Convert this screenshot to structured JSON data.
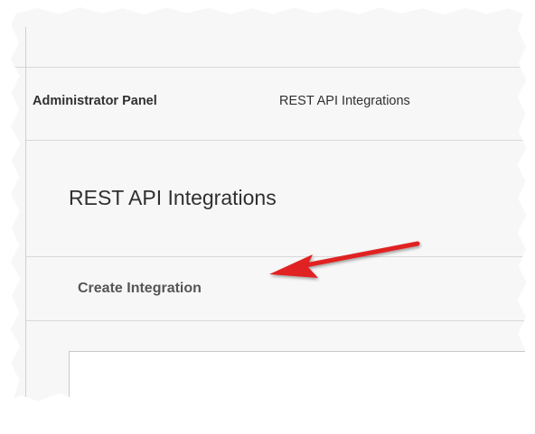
{
  "breadcrumb": {
    "admin_label": "Administrator Panel",
    "current_label": "REST API Integrations"
  },
  "page": {
    "title": "REST API Integrations"
  },
  "actions": {
    "create_label": "Create Integration"
  },
  "annotation": {
    "arrow_color": "#e02020"
  },
  "colors": {
    "background": "#f7f7f7",
    "divider": "#d9d9d9",
    "text": "#303030"
  }
}
